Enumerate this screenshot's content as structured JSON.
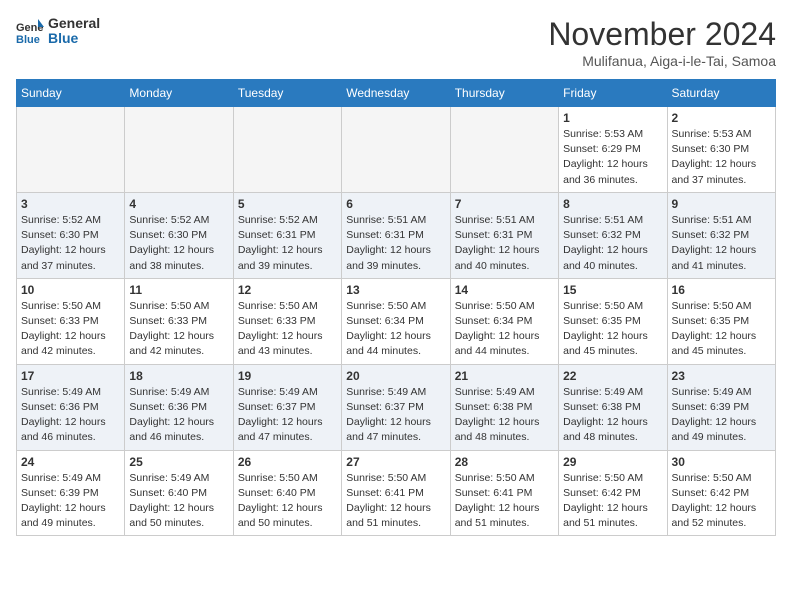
{
  "header": {
    "logo_general": "General",
    "logo_blue": "Blue",
    "month_title": "November 2024",
    "location": "Mulifanua, Aiga-i-le-Tai, Samoa"
  },
  "days_of_week": [
    "Sunday",
    "Monday",
    "Tuesday",
    "Wednesday",
    "Thursday",
    "Friday",
    "Saturday"
  ],
  "weeks": [
    [
      {
        "day": "",
        "info": ""
      },
      {
        "day": "",
        "info": ""
      },
      {
        "day": "",
        "info": ""
      },
      {
        "day": "",
        "info": ""
      },
      {
        "day": "",
        "info": ""
      },
      {
        "day": "1",
        "info": "Sunrise: 5:53 AM\nSunset: 6:29 PM\nDaylight: 12 hours and 36 minutes."
      },
      {
        "day": "2",
        "info": "Sunrise: 5:53 AM\nSunset: 6:30 PM\nDaylight: 12 hours and 37 minutes."
      }
    ],
    [
      {
        "day": "3",
        "info": "Sunrise: 5:52 AM\nSunset: 6:30 PM\nDaylight: 12 hours and 37 minutes."
      },
      {
        "day": "4",
        "info": "Sunrise: 5:52 AM\nSunset: 6:30 PM\nDaylight: 12 hours and 38 minutes."
      },
      {
        "day": "5",
        "info": "Sunrise: 5:52 AM\nSunset: 6:31 PM\nDaylight: 12 hours and 39 minutes."
      },
      {
        "day": "6",
        "info": "Sunrise: 5:51 AM\nSunset: 6:31 PM\nDaylight: 12 hours and 39 minutes."
      },
      {
        "day": "7",
        "info": "Sunrise: 5:51 AM\nSunset: 6:31 PM\nDaylight: 12 hours and 40 minutes."
      },
      {
        "day": "8",
        "info": "Sunrise: 5:51 AM\nSunset: 6:32 PM\nDaylight: 12 hours and 40 minutes."
      },
      {
        "day": "9",
        "info": "Sunrise: 5:51 AM\nSunset: 6:32 PM\nDaylight: 12 hours and 41 minutes."
      }
    ],
    [
      {
        "day": "10",
        "info": "Sunrise: 5:50 AM\nSunset: 6:33 PM\nDaylight: 12 hours and 42 minutes."
      },
      {
        "day": "11",
        "info": "Sunrise: 5:50 AM\nSunset: 6:33 PM\nDaylight: 12 hours and 42 minutes."
      },
      {
        "day": "12",
        "info": "Sunrise: 5:50 AM\nSunset: 6:33 PM\nDaylight: 12 hours and 43 minutes."
      },
      {
        "day": "13",
        "info": "Sunrise: 5:50 AM\nSunset: 6:34 PM\nDaylight: 12 hours and 44 minutes."
      },
      {
        "day": "14",
        "info": "Sunrise: 5:50 AM\nSunset: 6:34 PM\nDaylight: 12 hours and 44 minutes."
      },
      {
        "day": "15",
        "info": "Sunrise: 5:50 AM\nSunset: 6:35 PM\nDaylight: 12 hours and 45 minutes."
      },
      {
        "day": "16",
        "info": "Sunrise: 5:50 AM\nSunset: 6:35 PM\nDaylight: 12 hours and 45 minutes."
      }
    ],
    [
      {
        "day": "17",
        "info": "Sunrise: 5:49 AM\nSunset: 6:36 PM\nDaylight: 12 hours and 46 minutes."
      },
      {
        "day": "18",
        "info": "Sunrise: 5:49 AM\nSunset: 6:36 PM\nDaylight: 12 hours and 46 minutes."
      },
      {
        "day": "19",
        "info": "Sunrise: 5:49 AM\nSunset: 6:37 PM\nDaylight: 12 hours and 47 minutes."
      },
      {
        "day": "20",
        "info": "Sunrise: 5:49 AM\nSunset: 6:37 PM\nDaylight: 12 hours and 47 minutes."
      },
      {
        "day": "21",
        "info": "Sunrise: 5:49 AM\nSunset: 6:38 PM\nDaylight: 12 hours and 48 minutes."
      },
      {
        "day": "22",
        "info": "Sunrise: 5:49 AM\nSunset: 6:38 PM\nDaylight: 12 hours and 48 minutes."
      },
      {
        "day": "23",
        "info": "Sunrise: 5:49 AM\nSunset: 6:39 PM\nDaylight: 12 hours and 49 minutes."
      }
    ],
    [
      {
        "day": "24",
        "info": "Sunrise: 5:49 AM\nSunset: 6:39 PM\nDaylight: 12 hours and 49 minutes."
      },
      {
        "day": "25",
        "info": "Sunrise: 5:49 AM\nSunset: 6:40 PM\nDaylight: 12 hours and 50 minutes."
      },
      {
        "day": "26",
        "info": "Sunrise: 5:50 AM\nSunset: 6:40 PM\nDaylight: 12 hours and 50 minutes."
      },
      {
        "day": "27",
        "info": "Sunrise: 5:50 AM\nSunset: 6:41 PM\nDaylight: 12 hours and 51 minutes."
      },
      {
        "day": "28",
        "info": "Sunrise: 5:50 AM\nSunset: 6:41 PM\nDaylight: 12 hours and 51 minutes."
      },
      {
        "day": "29",
        "info": "Sunrise: 5:50 AM\nSunset: 6:42 PM\nDaylight: 12 hours and 51 minutes."
      },
      {
        "day": "30",
        "info": "Sunrise: 5:50 AM\nSunset: 6:42 PM\nDaylight: 12 hours and 52 minutes."
      }
    ]
  ]
}
